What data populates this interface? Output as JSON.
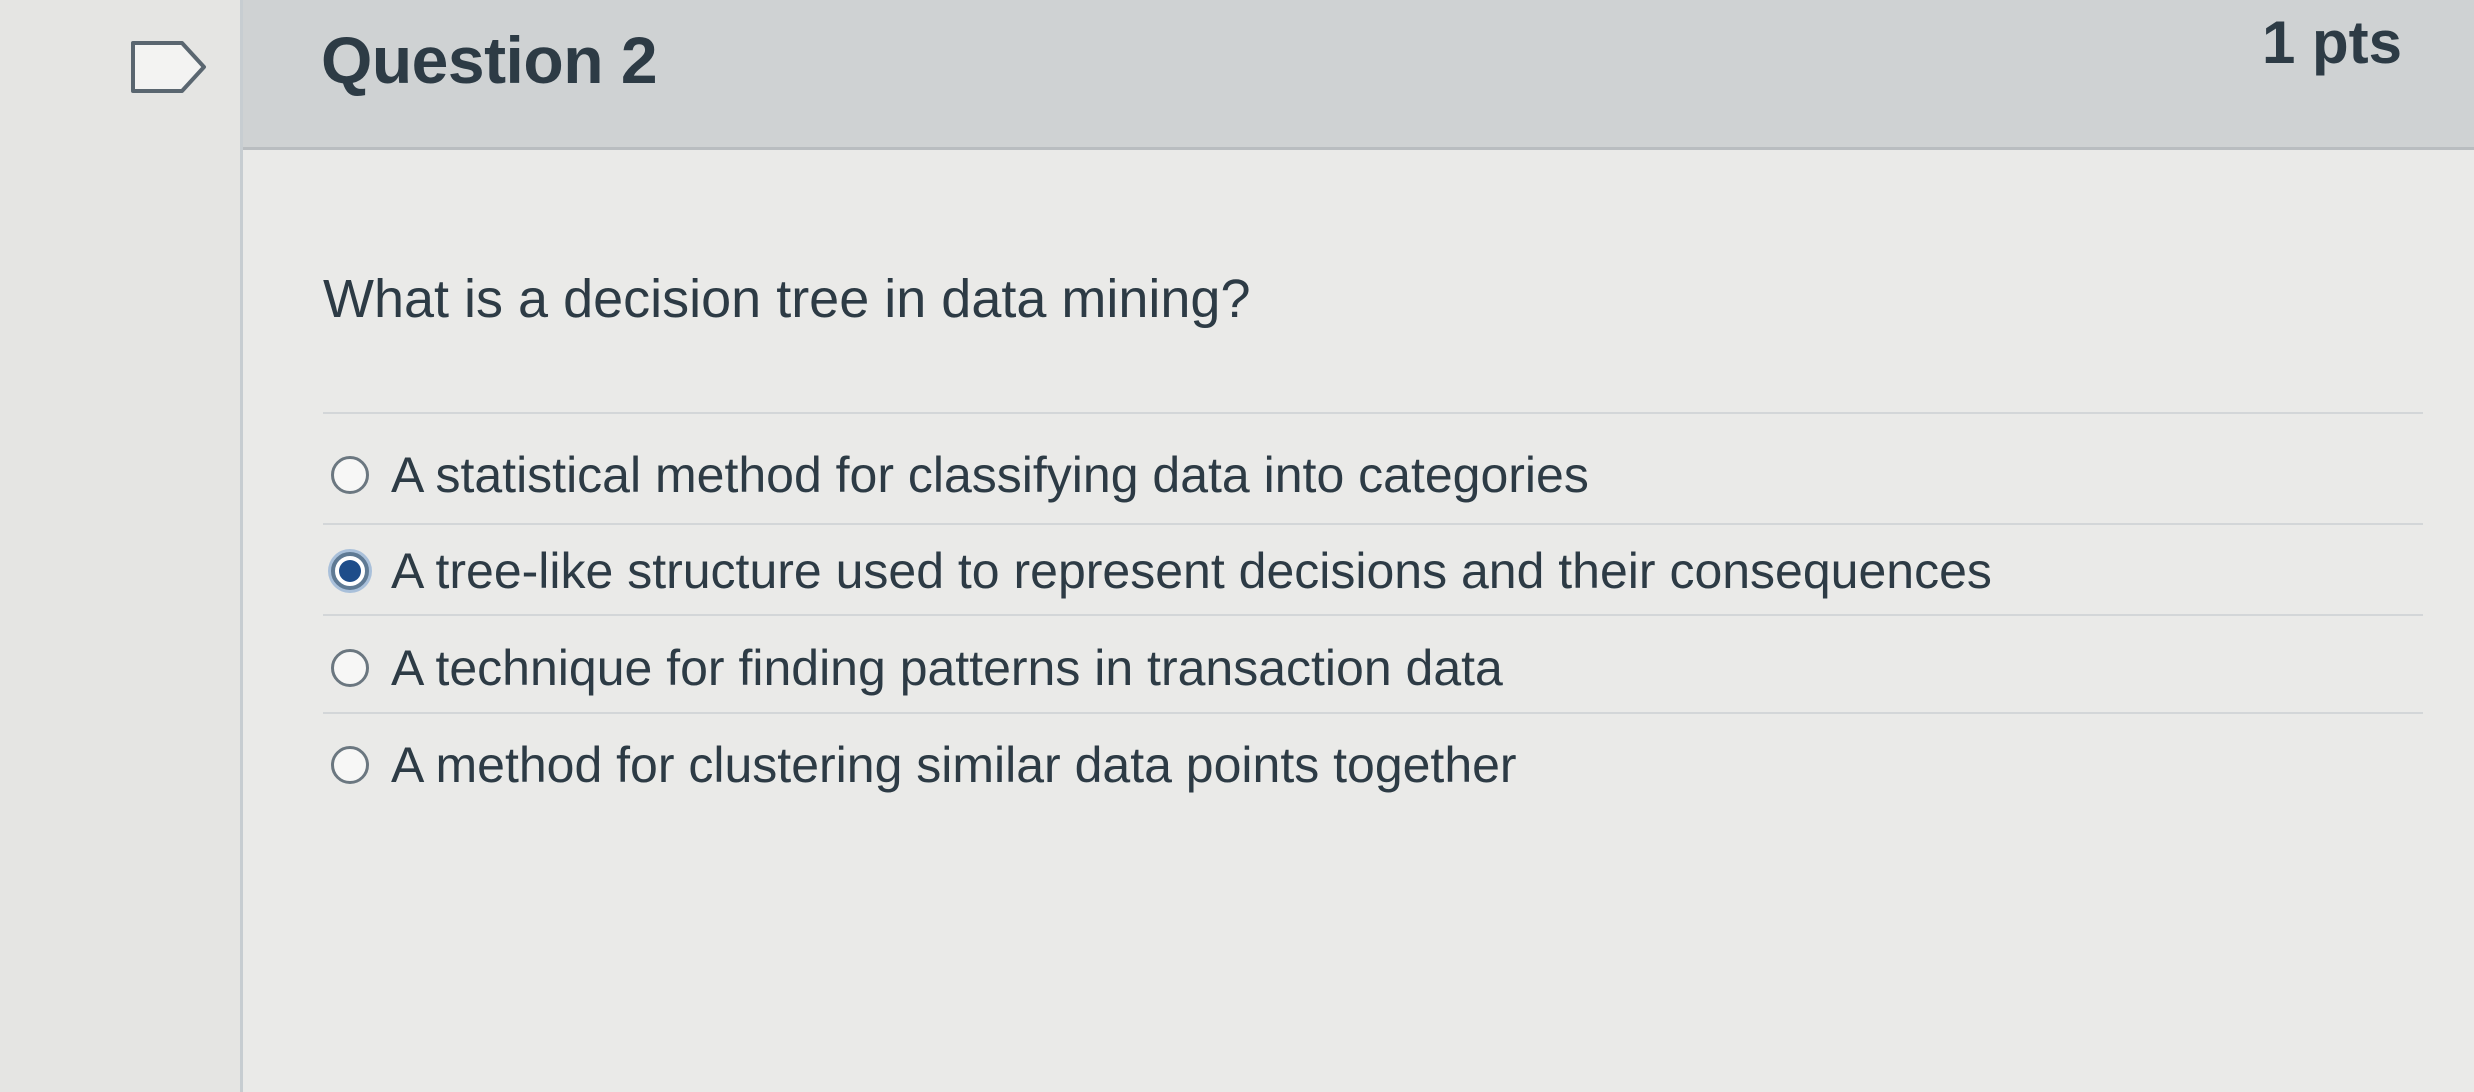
{
  "question": {
    "title": "Question 2",
    "points": "1 pts",
    "text": "What is a decision tree in data mining?",
    "answers": [
      {
        "label": "A statistical method for classifying data into categories",
        "selected": false
      },
      {
        "label": "A tree-like structure used to represent decisions and their consequences",
        "selected": true
      },
      {
        "label": "A technique for finding patterns in transaction data",
        "selected": false
      },
      {
        "label": "A method for clustering similar data points together",
        "selected": false
      }
    ]
  },
  "icons": {
    "flag": "flag-outline-icon"
  },
  "colors": {
    "header_background": "#cfd2d3",
    "text": "#2d3b45",
    "selected_radio": "#1e4d8a"
  }
}
